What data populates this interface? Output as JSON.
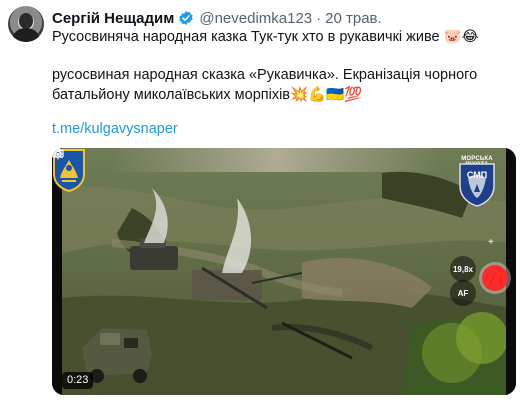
{
  "author": {
    "display_name": "Сергій Нещадим",
    "handle": "@nevedimka123",
    "separator": "·",
    "time": "20 трав."
  },
  "tweet": {
    "line1": "Русосвиняча народная казка Тук-тук хто в рукавичкі живе 🐷😂",
    "line2": "русосвиная народная сказка «Рукавичка». Екранізація чорного",
    "line3": "батальйону миколаївських морпіхів💥💪🇺🇦💯",
    "link": "t.me/kulgavysnaper"
  },
  "media": {
    "emblem_caption": "МОРСЬКА ПІХОТА",
    "emblem_text": "СМП",
    "zoom": "19,8x",
    "af": "AF",
    "plus": "+",
    "duration": "0:23"
  },
  "colors": {
    "link": "#1d9bf0",
    "verified": "#1d9bf0",
    "record": "#ff2b2b",
    "secondary_text": "#536471"
  },
  "icons": [
    "verified-badge-icon",
    "record-icon",
    "plus-icon",
    "camera-icon",
    "gear-icon"
  ]
}
